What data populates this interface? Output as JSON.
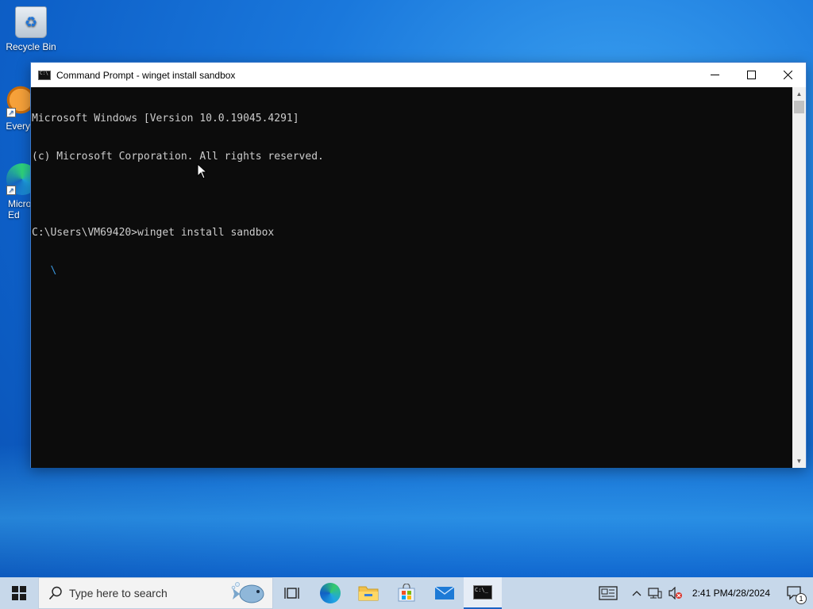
{
  "desktop": {
    "icons": [
      {
        "label": "Recycle Bin"
      },
      {
        "label": "Every"
      },
      {
        "label": "Micro Ed"
      }
    ]
  },
  "window": {
    "title": "Command Prompt - winget  install sandbox",
    "controls": {
      "minimize": "—",
      "maximize": "☐",
      "close": "✕"
    },
    "console_lines": [
      "Microsoft Windows [Version 10.0.19045.4291]",
      "(c) Microsoft Corporation. All rights reserved.",
      "",
      "C:\\Users\\VM69420>winget install sandbox",
      "   \\"
    ]
  },
  "taskbar": {
    "search_placeholder": "Type here to search",
    "apps": [
      "task-view",
      "edge",
      "file-explorer",
      "microsoft-store",
      "mail",
      "command-prompt"
    ],
    "clock": {
      "time": "2:41 PM",
      "date": "4/28/2024"
    },
    "notification_count": "1"
  },
  "colors": {
    "console_bg": "#0c0c0c",
    "console_fg": "#cccccc",
    "taskbar_bg": "#c7d8ea",
    "desktop_blue": "#1a78dc"
  }
}
